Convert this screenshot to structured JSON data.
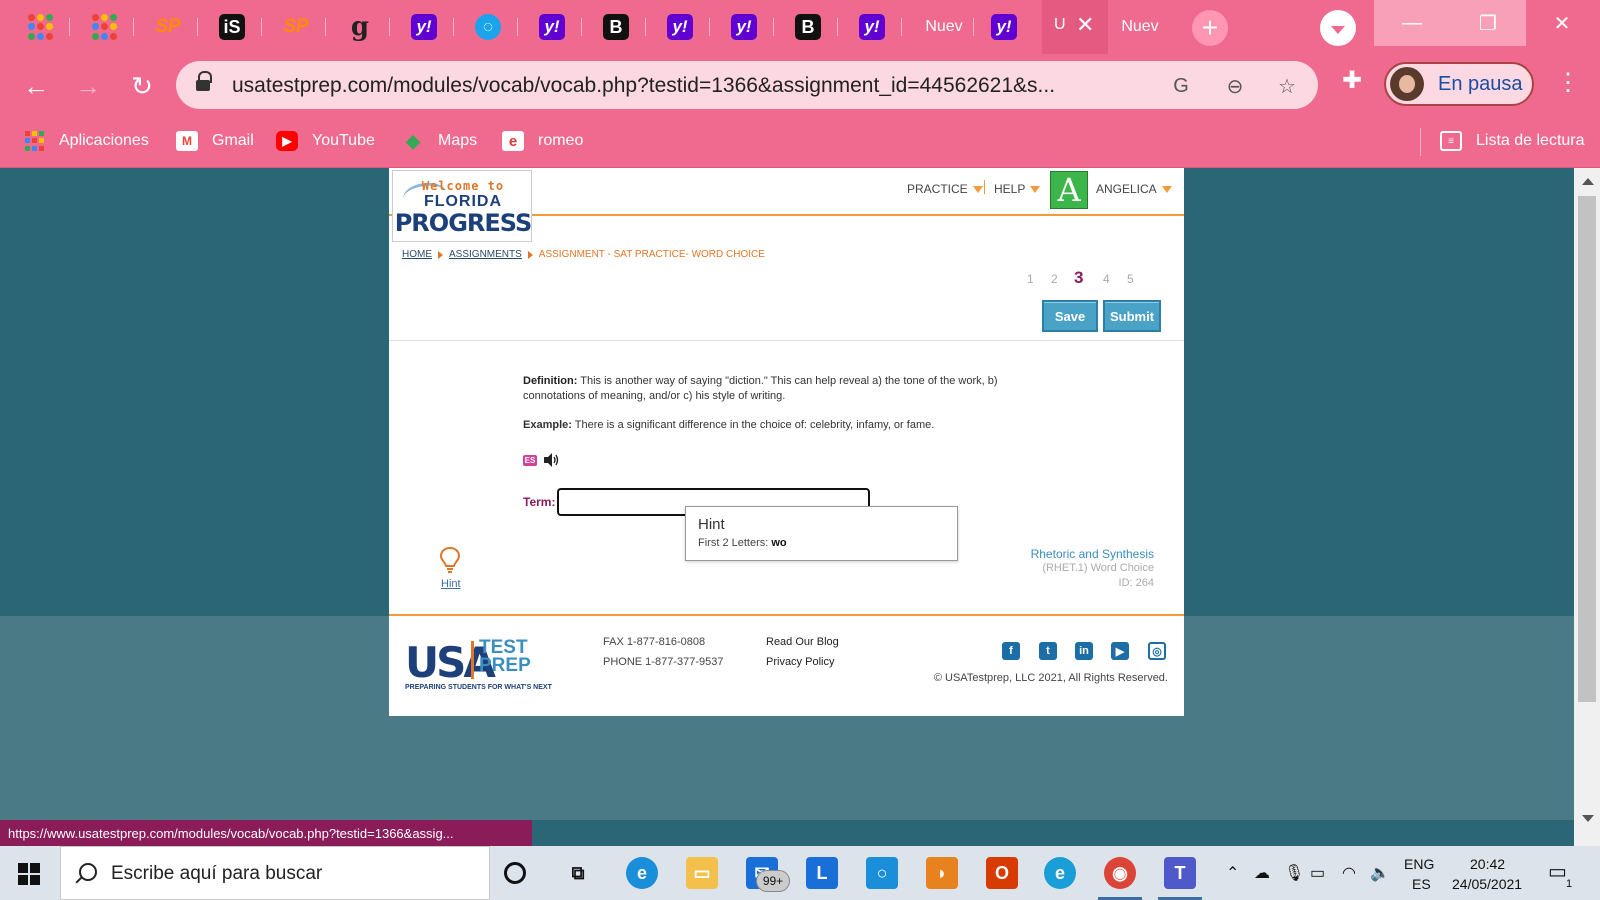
{
  "browser": {
    "tabs": [
      {
        "icon": "google-apps-icon",
        "text": ""
      },
      {
        "icon": "google-apps-icon",
        "text": ""
      },
      {
        "icon": "sp-icon",
        "text": "SP"
      },
      {
        "icon": "is-icon",
        "text": "iS"
      },
      {
        "icon": "sp-icon",
        "text": "SP"
      },
      {
        "icon": "goodreads-icon",
        "text": "g"
      },
      {
        "icon": "yahoo-icon",
        "text": "y!"
      },
      {
        "icon": "circle-blue-icon",
        "text": ""
      },
      {
        "icon": "yahoo-icon",
        "text": "y!"
      },
      {
        "icon": "brainly-icon",
        "text": "B"
      },
      {
        "icon": "yahoo-icon",
        "text": "y!"
      },
      {
        "icon": "yahoo-icon",
        "text": "y!"
      },
      {
        "icon": "brainly-icon",
        "text": "B"
      },
      {
        "icon": "yahoo-icon",
        "text": "y!"
      },
      {
        "icon": "",
        "text": "Nuev"
      },
      {
        "icon": "yahoo-icon",
        "text": "y!"
      }
    ],
    "active_tab_text": "U",
    "last_tab_text": "Nuev",
    "url": "usatestprep.com/modules/vocab/vocab.php?testid=1366&assignment_id=44562621&s...",
    "profile_label": "En pausa",
    "bookmarks": [
      {
        "label": "Aplicaciones",
        "icon": "apps-grid-icon"
      },
      {
        "label": "Gmail",
        "icon": "gmail-icon"
      },
      {
        "label": "YouTube",
        "icon": "youtube-icon"
      },
      {
        "label": "Maps",
        "icon": "maps-icon"
      },
      {
        "label": "romeo",
        "icon": "e-icon"
      }
    ],
    "reading_list": "Lista de lectura",
    "status_url": "https://www.usatestprep.com/modules/vocab/vocab.php?testid=1366&assig..."
  },
  "site": {
    "logo": {
      "welcome": "Welcome to",
      "florida": "FLORIDA",
      "progress": "PROGRESS"
    },
    "nav": {
      "practice": "PRACTICE",
      "help": "HELP",
      "avatar_letter": "A",
      "user": "ANGELICA"
    },
    "breadcrumb": {
      "home": "HOME",
      "assignments": "ASSIGNMENTS",
      "current": "ASSIGNMENT - SAT PRACTICE- WORD CHOICE"
    },
    "pager": [
      "1",
      "2",
      "3",
      "4",
      "5"
    ],
    "pager_current": "3",
    "save": "Save",
    "submit": "Submit",
    "definition_label": "Definition:",
    "definition_text": "This is another way of saying \"diction.\" This can help reveal a) the tone of the work, b) connotations of meaning, and/or c) his style of writing.",
    "example_label": "Example:",
    "example_text": "There is a significant difference in the choice of: celebrity, infamy, or fame.",
    "es_badge": "ES",
    "term_label": "Term:",
    "term_value": "",
    "hint_popup": {
      "title": "Hint",
      "prefix": "First 2 Letters:",
      "letters": "wo"
    },
    "hint_link": "Hint",
    "standard": {
      "title": "Rhetoric and Synthesis",
      "sub": "(RHET.1) Word Choice",
      "id": "ID: 264"
    },
    "footer": {
      "usa": "USA",
      "test": "TEST",
      "prep": "PREP",
      "tagline": "PREPARING STUDENTS FOR WHAT'S NEXT",
      "fax": "FAX 1-877-816-0808",
      "phone": "PHONE 1-877-377-9537",
      "blog": "Read Our Blog",
      "privacy": "Privacy Policy",
      "copyright": "© USATestprep, LLC 2021, All Rights Reserved.",
      "social": [
        "facebook-icon",
        "twitter-icon",
        "linkedin-icon",
        "youtube-icon",
        "instagram-icon"
      ]
    }
  },
  "taskbar": {
    "search_placeholder": "Escribe aquí para buscar",
    "mail_badge": "99+",
    "lang_top": "ENG",
    "lang_bottom": "ES",
    "time": "20:42",
    "date": "24/05/2021",
    "notif_count": "1"
  }
}
